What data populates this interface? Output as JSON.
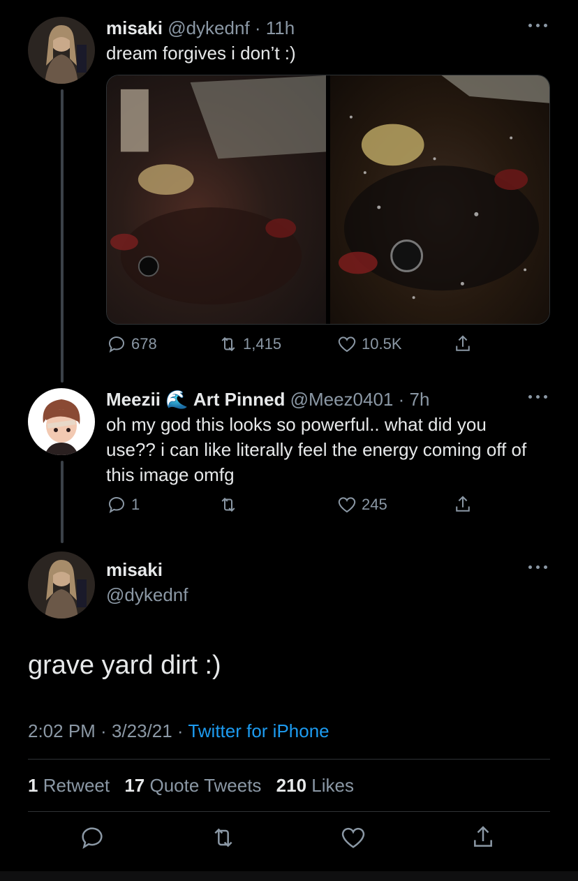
{
  "tweet1": {
    "name": "misaki",
    "handle": "@dykednf",
    "sep": " · ",
    "time": "11h",
    "text": "dream forgives i don’t :)",
    "replies": "678",
    "retweets": "1,415",
    "likes": "10.5K"
  },
  "tweet2": {
    "name": "Meezii",
    "emoji": "🌊",
    "name_suffix": "Art Pinned",
    "handle": "@Meez0401",
    "sep": " · ",
    "time": "7h",
    "text": "oh my god this looks so powerful.. what did you use?? i can like literally feel the energy coming off of this image omfg",
    "replies": "1",
    "retweets": "",
    "likes": "245"
  },
  "main": {
    "name": "misaki",
    "handle": "@dykednf",
    "text": "grave yard dirt :)",
    "time": "2:02 PM",
    "sep1": " · ",
    "date": "3/23/21",
    "sep2": " · ",
    "source": "Twitter for iPhone",
    "retweet_count": "1",
    "retweet_label": "Retweet",
    "quote_count": "17",
    "quote_label": "Quote Tweets",
    "like_count": "210",
    "like_label": "Likes"
  },
  "icons": {
    "reply": "reply-icon",
    "retweet": "retweet-icon",
    "like": "heart-icon",
    "share": "share-icon",
    "more": "more-icon"
  },
  "colors": {
    "background": "#000000",
    "text": "#e7e9ea",
    "muted": "#8b98a5",
    "link": "#1d9bf0"
  }
}
